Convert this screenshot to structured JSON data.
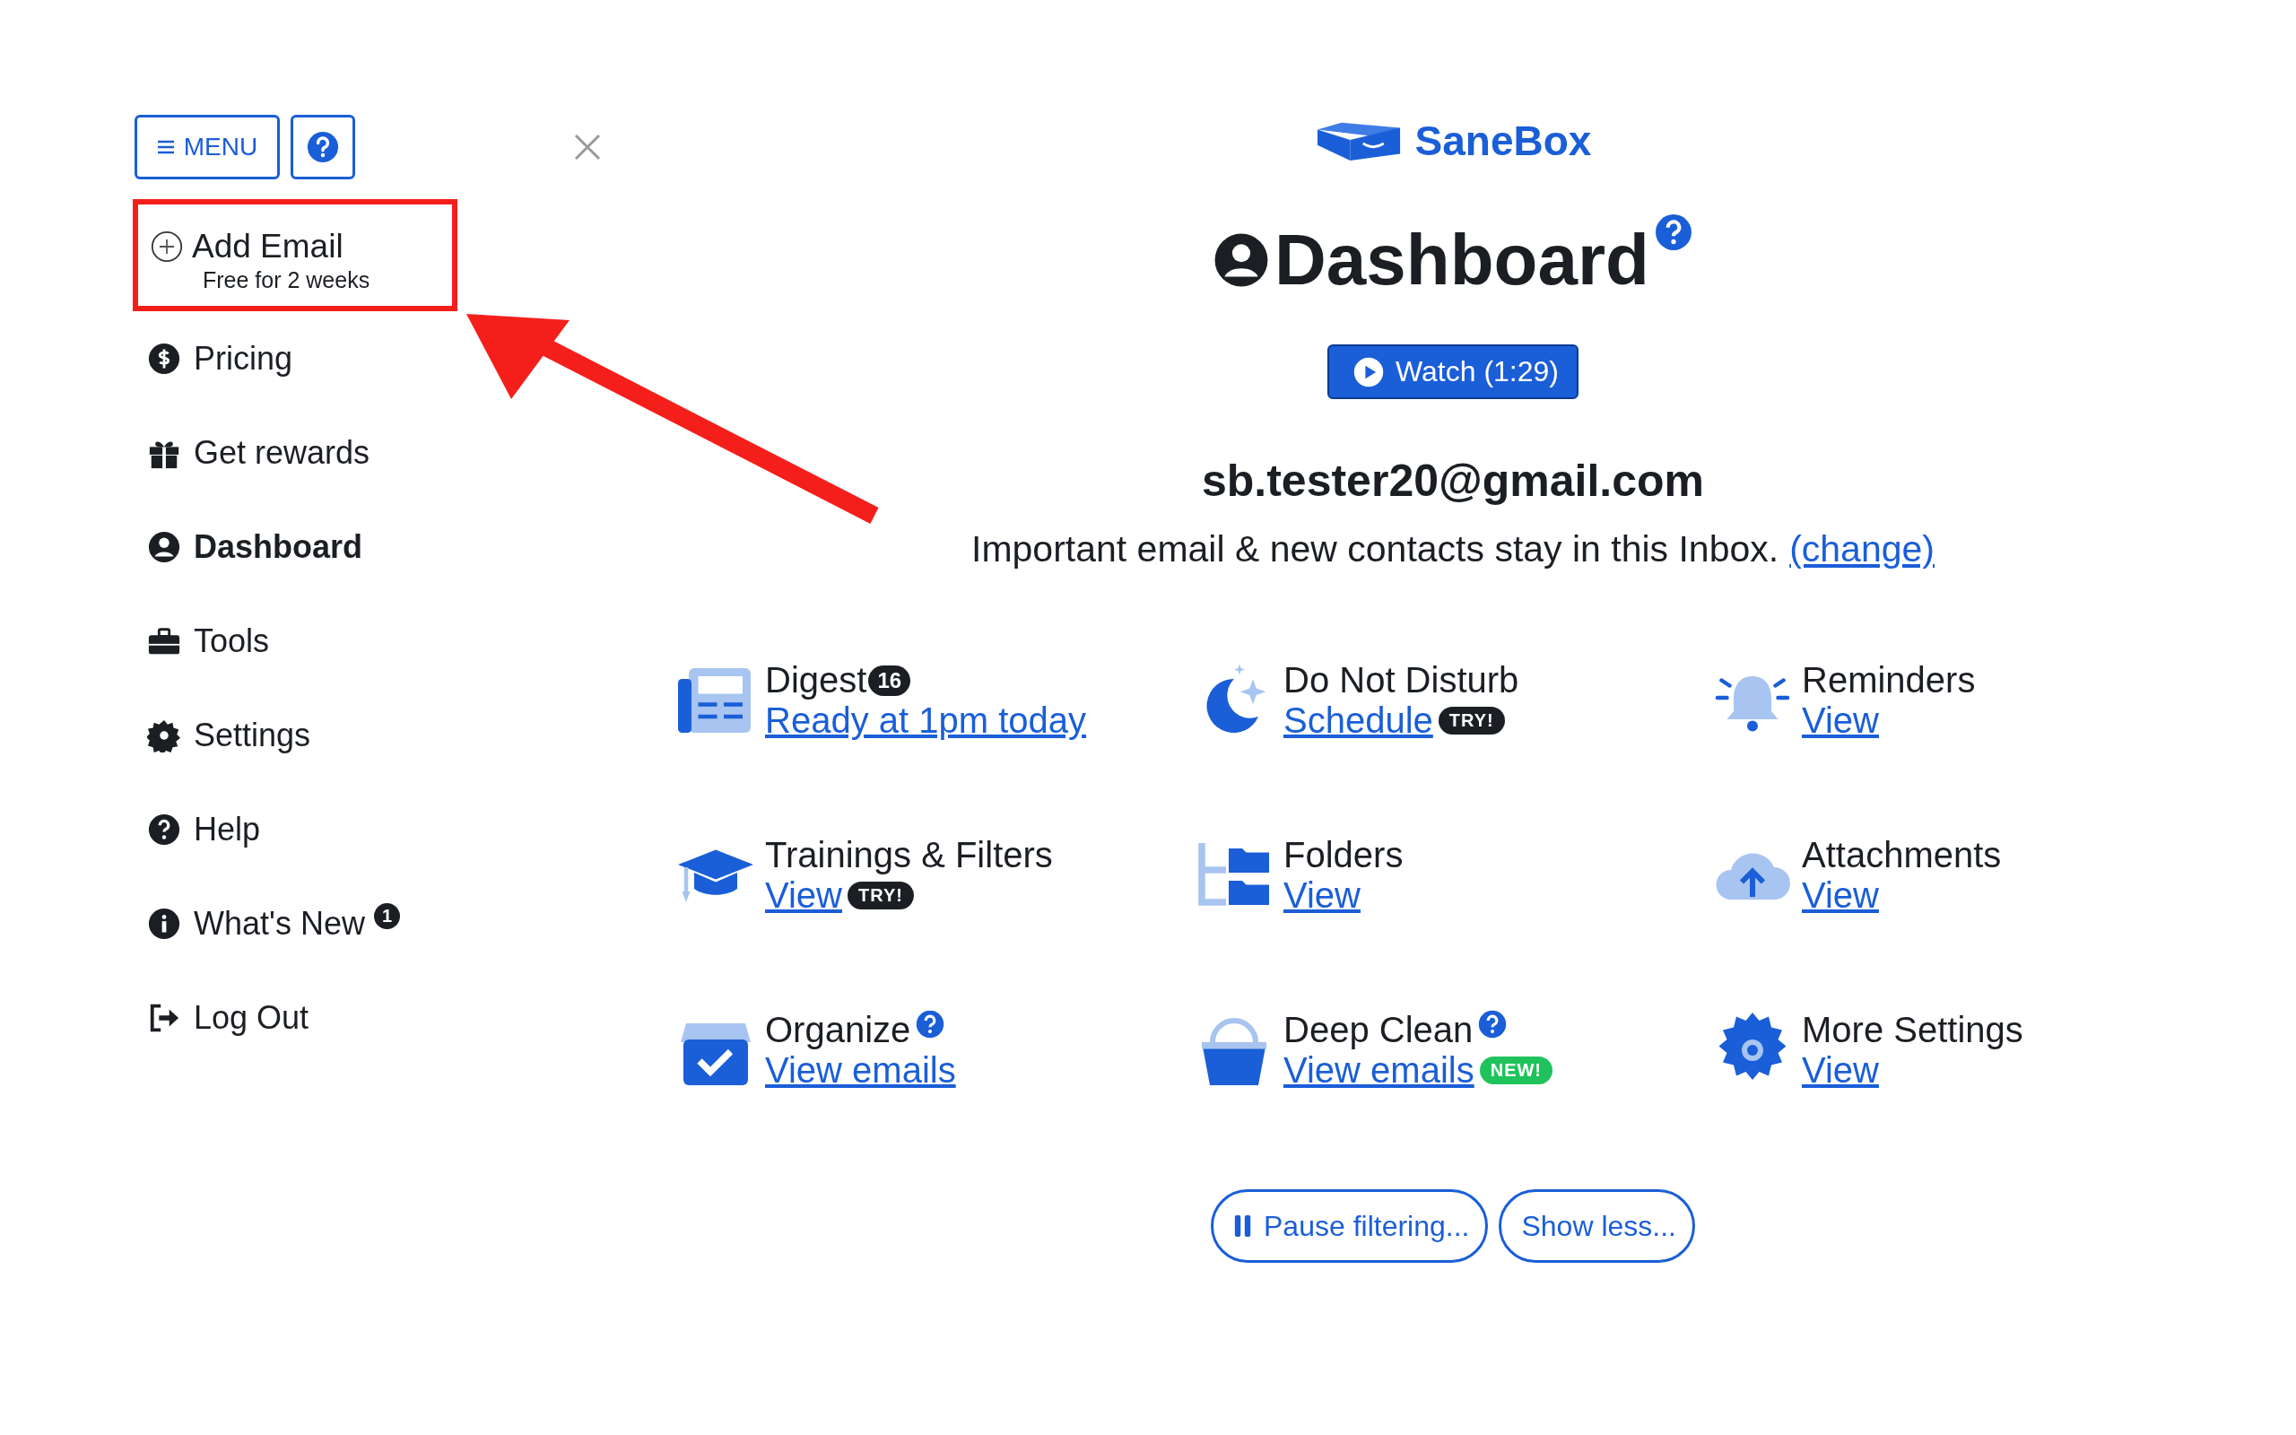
{
  "sidebar": {
    "menu_button": "MENU",
    "add_email": {
      "label": "Add Email",
      "sub": "Free for 2 weeks",
      "highlighted": true
    },
    "items": [
      {
        "label": "Pricing",
        "selected": false
      },
      {
        "label": "Get rewards",
        "selected": false
      },
      {
        "label": "Dashboard",
        "selected": true
      },
      {
        "label": "Tools",
        "selected": false
      },
      {
        "label": "Settings",
        "selected": false
      },
      {
        "label": "Help",
        "selected": false
      },
      {
        "label": "What's New",
        "selected": false,
        "badge": "1"
      },
      {
        "label": "Log Out",
        "selected": false
      }
    ]
  },
  "brand": "SaneBox",
  "title": "Dashboard",
  "watch_button": "Watch (1:29)",
  "email": "sb.tester20@gmail.com",
  "description": "Important email & new contacts stay in this Inbox.",
  "change_link": "(change)",
  "tiles": [
    {
      "title": "Digest",
      "title_badge": {
        "kind": "count",
        "text": "16"
      },
      "link": "Ready at 1pm today"
    },
    {
      "title": "Do Not Disturb",
      "link": "Schedule",
      "link_badge": {
        "kind": "try",
        "text": "TRY!"
      }
    },
    {
      "title": "Reminders",
      "link": "View"
    },
    {
      "title": "Trainings & Filters",
      "link": "View",
      "link_badge": {
        "kind": "try",
        "text": "TRY!"
      }
    },
    {
      "title": "Folders",
      "link": "View"
    },
    {
      "title": "Attachments",
      "link": "View"
    },
    {
      "title": "Organize",
      "title_badge": {
        "kind": "help"
      },
      "link": "View emails"
    },
    {
      "title": "Deep Clean",
      "title_badge": {
        "kind": "help"
      },
      "link": "View emails",
      "link_badge": {
        "kind": "new",
        "text": "NEW!"
      }
    },
    {
      "title": "More Settings",
      "link": "View"
    }
  ],
  "bottom_buttons": [
    {
      "kind": "pause",
      "label": "Pause filtering..."
    },
    {
      "kind": "plain",
      "label": "Show less..."
    }
  ]
}
